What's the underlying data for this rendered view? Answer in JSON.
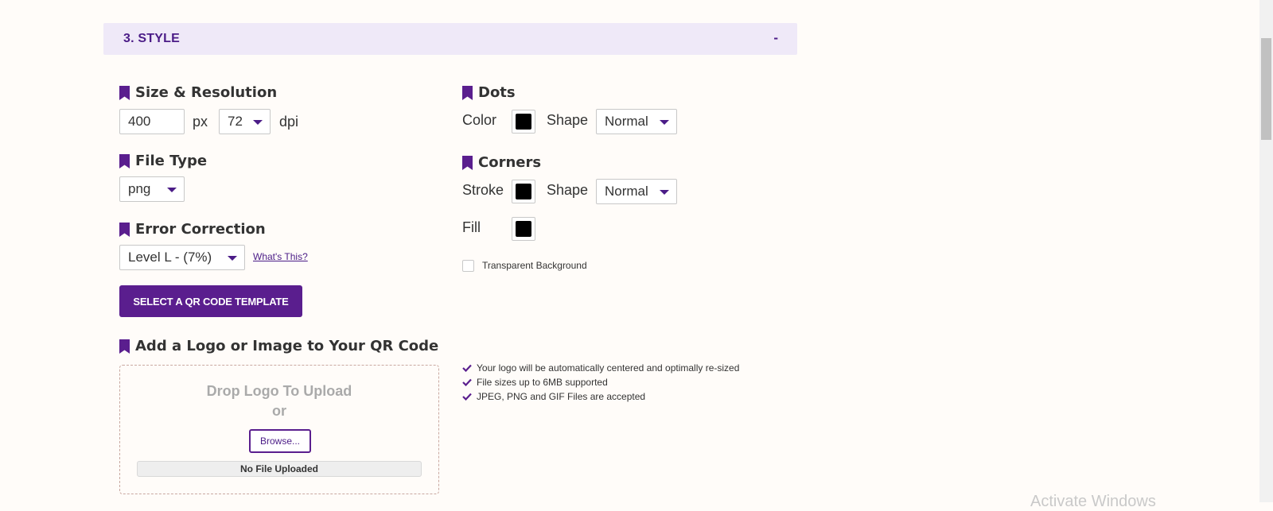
{
  "section": {
    "title": "3. STYLE",
    "toggle": "-"
  },
  "size_resolution": {
    "heading": "Size & Resolution",
    "size_value": "400",
    "size_unit": "px",
    "dpi_value": "72",
    "dpi_unit": "dpi"
  },
  "file_type": {
    "heading": "File Type",
    "value": "png"
  },
  "error_correction": {
    "heading": "Error Correction",
    "value": "Level L - (7%)",
    "help_link": "What's This?"
  },
  "template_button": "SELECT A QR CODE TEMPLATE",
  "dots": {
    "heading": "Dots",
    "color_label": "Color",
    "color": "#000000",
    "shape_label": "Shape",
    "shape_value": "Normal"
  },
  "corners": {
    "heading": "Corners",
    "stroke_label": "Stroke",
    "stroke_color": "#000000",
    "shape_label": "Shape",
    "shape_value": "Normal",
    "fill_label": "Fill",
    "fill_color": "#000000"
  },
  "transparent_bg": {
    "label": "Transparent Background",
    "checked": false
  },
  "logo": {
    "heading": "Add a Logo or Image to Your QR Code",
    "drop_text": "Drop Logo To Upload",
    "or_text": "or",
    "browse_label": "Browse...",
    "file_status": "No File Uploaded",
    "features": [
      "Your logo will be automatically centered and optimally re-sized",
      "File sizes up to 6MB supported",
      "JPEG, PNG and GIF Files are accepted"
    ]
  },
  "watermark": "Activate Windows",
  "colors": {
    "accent": "#5a1e8e",
    "header_bg": "#efe9f8",
    "page_bg": "#fffcf9"
  },
  "icons": {
    "heading": "bookmark-icon",
    "dropdown": "caret-down-icon",
    "feature": "checkmark-icon"
  }
}
